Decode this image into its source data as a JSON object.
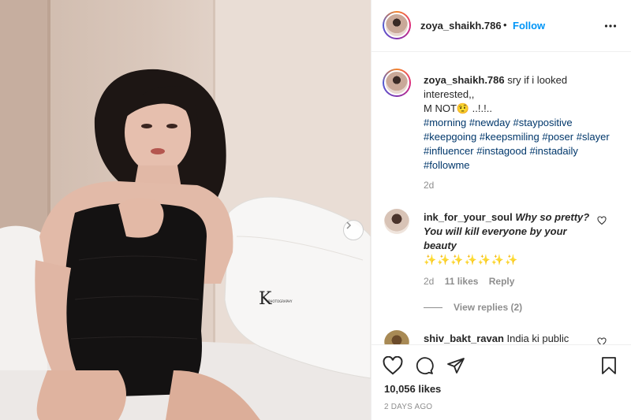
{
  "post": {
    "username": "zoya_shaikh.786",
    "separator": "•",
    "follow_label": "Follow",
    "watermark_text": "PHOTOGRAPHY"
  },
  "caption": {
    "username": "zoya_shaikh.786",
    "line1": "sry if i looked interested,,",
    "line2": "M NOT🤨 ..!.!..",
    "hashtags": [
      "#morning",
      "#newday",
      "#staypositive",
      "#keepgoing",
      "#keepsmiling",
      "#poser",
      "#slayer",
      "#influencer",
      "#instagood",
      "#instadaily",
      "#followme"
    ],
    "age": "2d"
  },
  "comments": [
    {
      "username": "ink_for_your_soul",
      "text": "Why so pretty?You will kill everyone by your beauty",
      "sparkles": "✨✨✨✨✨✨✨",
      "age": "2d",
      "likes": "11 likes",
      "reply_label": "Reply",
      "view_replies": "View replies (2)"
    },
    {
      "username": "shiv_bakt_ravan",
      "text": "India ki public"
    }
  ],
  "footer": {
    "likes": "10,056 likes",
    "date": "2 DAYS AGO"
  },
  "icons": {
    "more": "more-horizontal-icon",
    "like": "heart-icon",
    "comment": "comment-icon",
    "share": "share-icon",
    "save": "bookmark-icon",
    "next": "chevron-right-icon"
  },
  "colors": {
    "accent": "#0095f6",
    "hashtag": "#00376b",
    "muted": "#8e8e8e",
    "text": "#262626"
  }
}
